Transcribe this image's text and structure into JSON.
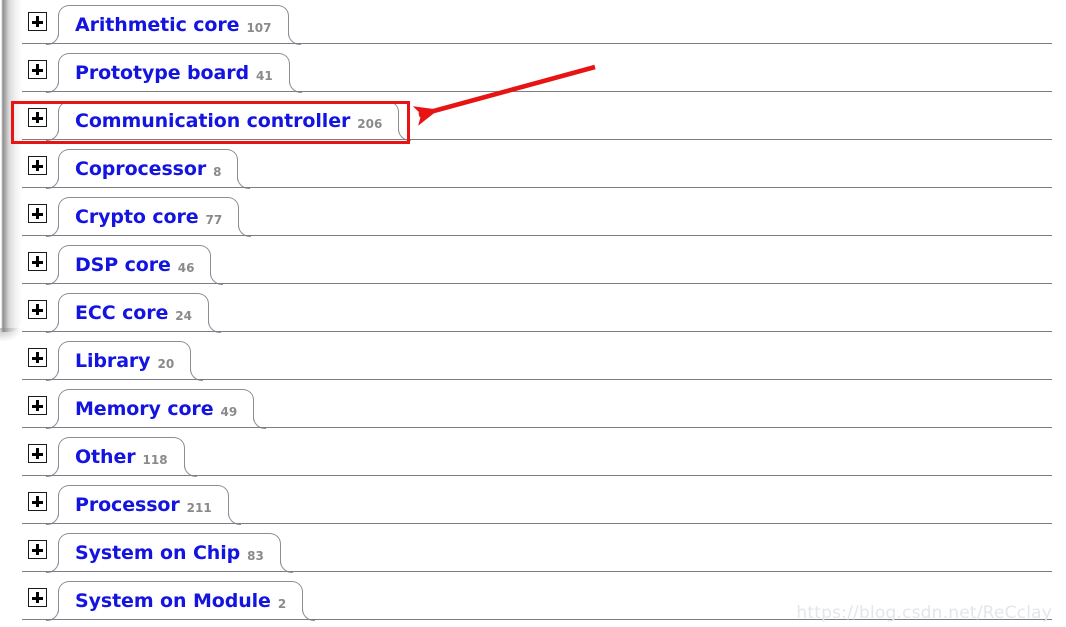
{
  "page": {
    "title": "OpenCores project categories",
    "accent_link_color": "#1414e0",
    "count_color": "#8a8a8a",
    "rule_color": "#7b7f85",
    "annotation_color": "#e81414"
  },
  "categories": [
    {
      "label": "Arithmetic core",
      "count": "107",
      "expander": "plus-icon",
      "highlighted": false
    },
    {
      "label": "Prototype board",
      "count": "41",
      "expander": "plus-icon",
      "highlighted": false
    },
    {
      "label": "Communication controller",
      "count": "206",
      "expander": "plus-icon",
      "highlighted": true
    },
    {
      "label": "Coprocessor",
      "count": "8",
      "expander": "plus-icon",
      "highlighted": false
    },
    {
      "label": "Crypto core",
      "count": "77",
      "expander": "plus-icon",
      "highlighted": false
    },
    {
      "label": "DSP core",
      "count": "46",
      "expander": "plus-icon",
      "highlighted": false
    },
    {
      "label": "ECC core",
      "count": "24",
      "expander": "plus-icon",
      "highlighted": false
    },
    {
      "label": "Library",
      "count": "20",
      "expander": "plus-icon",
      "highlighted": false
    },
    {
      "label": "Memory core",
      "count": "49",
      "expander": "plus-icon",
      "highlighted": false
    },
    {
      "label": "Other",
      "count": "118",
      "expander": "plus-icon",
      "highlighted": false
    },
    {
      "label": "Processor",
      "count": "211",
      "expander": "plus-icon",
      "highlighted": false
    },
    {
      "label": "System on Chip",
      "count": "83",
      "expander": "plus-icon",
      "highlighted": false
    },
    {
      "label": "System on Module",
      "count": "2",
      "expander": "plus-icon",
      "highlighted": false
    }
  ],
  "annotation": {
    "arrow_icon": "arrow-left-icon",
    "box_target": "Communication controller",
    "color": "#e81414"
  },
  "watermark": {
    "text": "https://blog.csdn.net/ReCclay"
  }
}
